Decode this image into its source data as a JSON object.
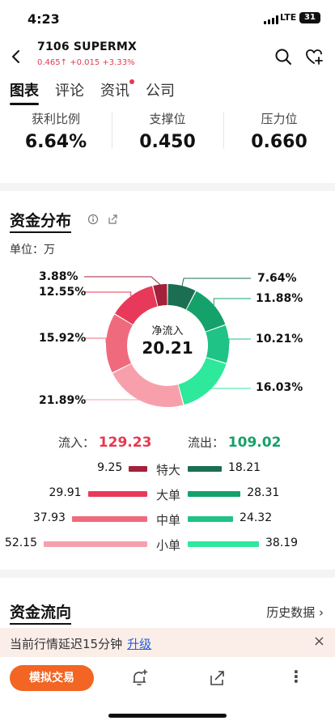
{
  "status": {
    "time": "4:23",
    "network": "LTE",
    "battery": "31"
  },
  "stock": {
    "title": "7106 SUPERMX",
    "price": "0.465",
    "change": "+0.015",
    "change_pct": "+3.33%"
  },
  "tabs": [
    {
      "label": "图表",
      "active": true
    },
    {
      "label": "评论"
    },
    {
      "label": "资讯",
      "dot": true
    },
    {
      "label": "公司"
    }
  ],
  "stats": [
    {
      "label": "获利比例",
      "value": "6.64%"
    },
    {
      "label": "支撑位",
      "value": "0.450"
    },
    {
      "label": "压力位",
      "value": "0.660"
    }
  ],
  "fund_dist": {
    "title": "资金分布",
    "unit": "单位：万",
    "center_label": "净流入",
    "center_value": "20.21",
    "in_label": "流入：",
    "in_value": "129.23",
    "out_label": "流出：",
    "out_value": "109.02",
    "left_pcts": [
      "3.88%",
      "12.55%",
      "15.92%",
      "21.89%"
    ],
    "right_pcts": [
      "7.64%",
      "11.88%",
      "10.21%",
      "16.03%"
    ],
    "rows": [
      {
        "cat": "特大",
        "in": "9.25",
        "out": "18.21"
      },
      {
        "cat": "大单",
        "in": "29.91",
        "out": "28.31"
      },
      {
        "cat": "中单",
        "in": "37.93",
        "out": "24.32"
      },
      {
        "cat": "小单",
        "in": "52.15",
        "out": "38.19"
      }
    ]
  },
  "fund_flow": {
    "title": "资金流向",
    "history": "历史数据 ›"
  },
  "notice": {
    "text": "当前行情延迟15分钟",
    "link": "升级",
    "close": "×"
  },
  "bottom": {
    "sim_trade": "模拟交易",
    "more": "⋮"
  },
  "colors": {
    "up": "#e53950",
    "down": "#17a06a",
    "in": [
      "#a3213a",
      "#e8395a",
      "#f06a7e",
      "#f7a0ac"
    ],
    "out": [
      "#1b6e51",
      "#14a26a",
      "#1fc386",
      "#2ee89c"
    ]
  },
  "chart_data": {
    "type": "pie",
    "title": "资金分布",
    "categories": [
      "特大流出",
      "大单流出",
      "中单流出",
      "小单流出",
      "小单流入",
      "中单流入",
      "大单流入",
      "特大流入"
    ],
    "values": [
      7.64,
      11.88,
      10.21,
      16.03,
      21.89,
      15.92,
      12.55,
      3.88
    ]
  }
}
